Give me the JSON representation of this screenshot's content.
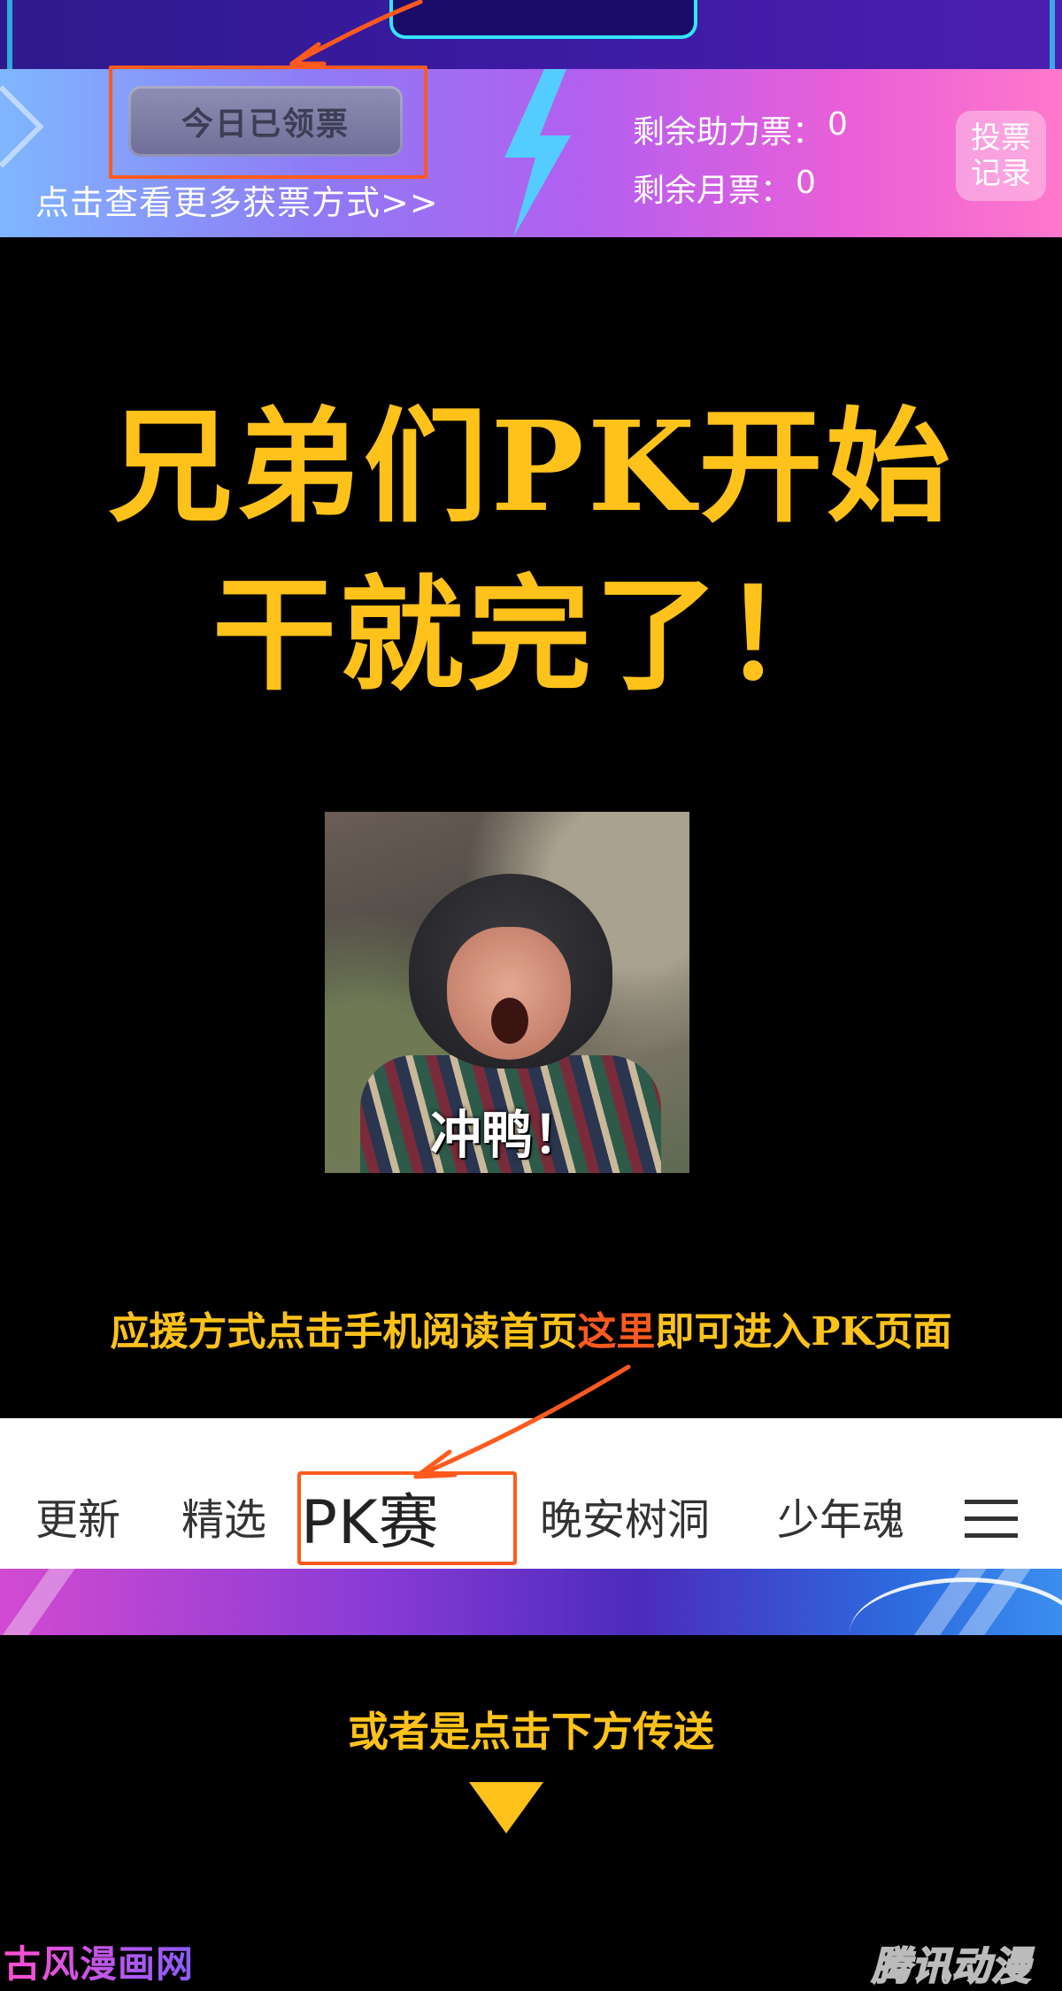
{
  "vote_banner": {
    "claimed_button_label": "今日已领票",
    "more_ways_link": "点击查看更多获票方式>>",
    "assist_tickets": {
      "label": "剩余助力票：",
      "value": "0"
    },
    "monthly_tickets": {
      "label": "剩余月票：",
      "value": "0"
    },
    "vote_record_button": {
      "line1": "投票",
      "line2": "记录"
    }
  },
  "headline": {
    "line1": "兄弟们PK开始",
    "line2": "干就完了！"
  },
  "meme": {
    "caption": "冲鸭！"
  },
  "instruction": {
    "before": "应援方式点击手机阅读首页",
    "highlight": "这里",
    "after": "即可进入PK页面"
  },
  "tabbar": {
    "tabs": [
      "更新",
      "精选",
      "PK赛",
      "晚安树洞",
      "少年魂"
    ],
    "menu_icon": "hamburger-menu-icon"
  },
  "teleport_text": "或者是点击下方传送",
  "watermarks": {
    "left": "古风漫画网",
    "right": "腾讯动漫"
  },
  "colors": {
    "headline": "#ffc21a",
    "highlight": "#ff5a1e",
    "background": "#000000"
  }
}
